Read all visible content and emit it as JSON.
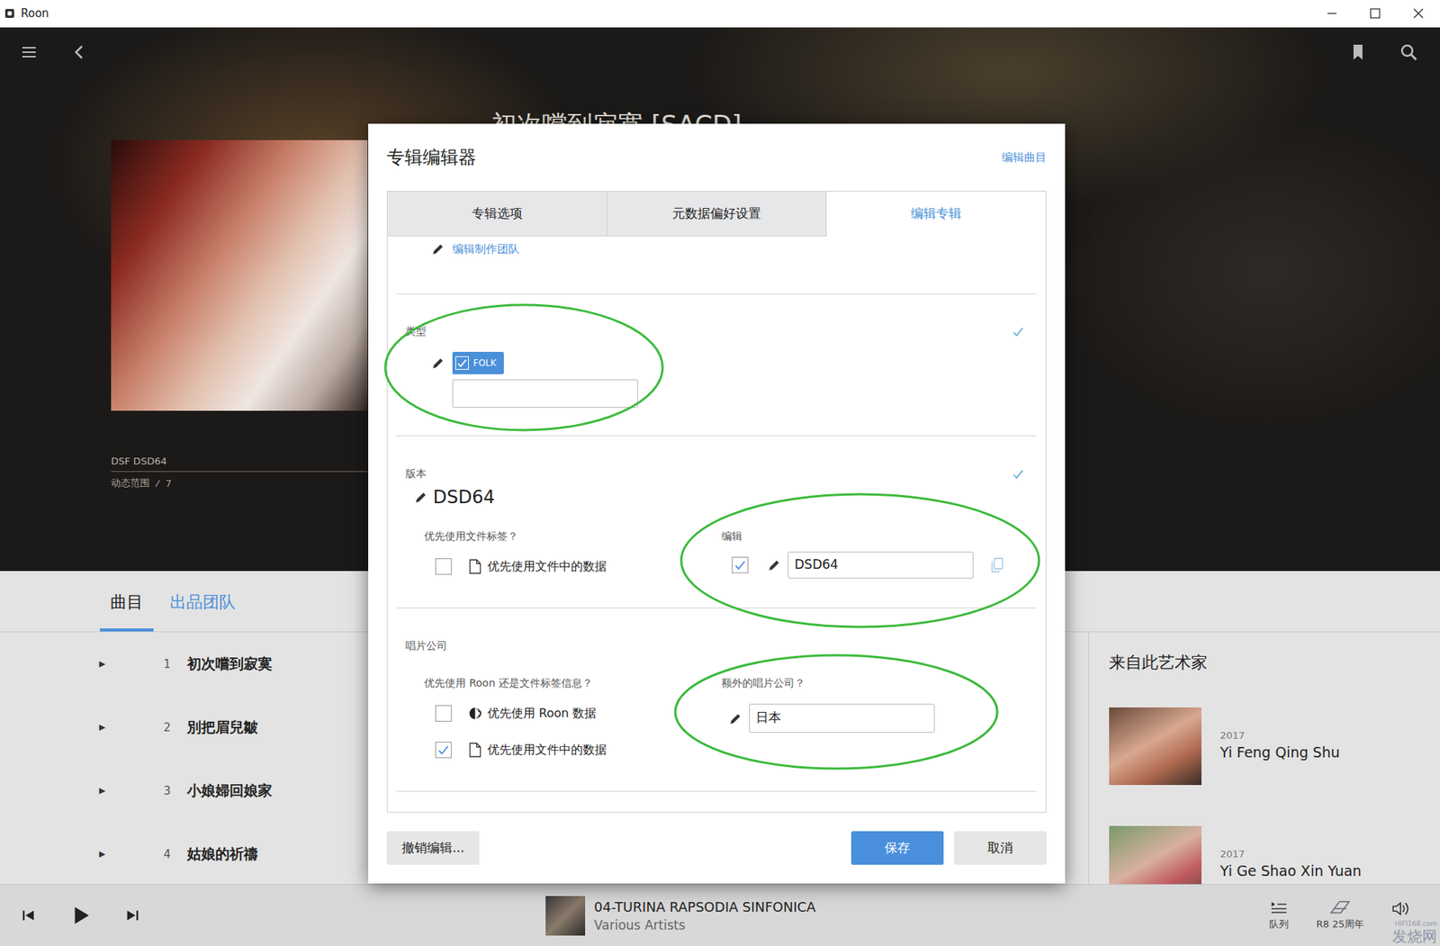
{
  "window": {
    "title": "Roon"
  },
  "album": {
    "title": "初次嚐到寂寞 [SACD]",
    "format": "DSF DSD64",
    "dynamic_range_label": "动态范围",
    "dynamic_range": "7"
  },
  "page_tabs": [
    {
      "label": "曲目",
      "selected": true
    },
    {
      "label": "出品团队",
      "selected": false
    }
  ],
  "tracks": {
    "glyph": "▶",
    "items": [
      {
        "number": "1",
        "title": "初次嚐到寂寞"
      },
      {
        "number": "2",
        "title": "別把眉兒皺"
      },
      {
        "number": "3",
        "title": "小娘婦回娘家"
      },
      {
        "number": "4",
        "title": "姑娘的祈禱"
      }
    ]
  },
  "artist_panel": {
    "title": "来自此艺术家",
    "albums": [
      {
        "year": "2017",
        "title": "Yi Feng Qing Shu"
      },
      {
        "year": "2017",
        "title": "Yi Ge Shao Xin Yuan"
      }
    ]
  },
  "player": {
    "track": "04-TURINA RAPSODIA SINFONICA",
    "artist": "Various Artists",
    "queue_label": "队列",
    "badge": "R8 25周年",
    "watermark_small": "HIFI168.com",
    "watermark": "发烧网"
  },
  "dialog": {
    "title": "专辑编辑器",
    "link": "编辑曲目",
    "tabs": [
      {
        "label": "专辑选项",
        "selected": false
      },
      {
        "label": "元数据偏好设置",
        "selected": false
      },
      {
        "label": "编辑专辑",
        "selected": true
      }
    ],
    "credits_link": "编辑制作团队",
    "genre": {
      "label": "类型",
      "confirmed": true,
      "tags": [
        {
          "label": "FOLK",
          "checked": true
        }
      ],
      "input": ""
    },
    "version": {
      "label": "版本",
      "value": "DSD64",
      "confirmed": true,
      "prefer_label": "优先使用文件标签？",
      "prefer_option": {
        "label": "优先使用文件中的数据",
        "checked": false
      },
      "edit_label": "编辑",
      "edit_checked": true,
      "edit_value": "DSD64"
    },
    "record_label": {
      "label": "唱片公司",
      "prefer_label": "优先使用 Roon 还是文件标签信息？",
      "options": [
        {
          "label": "优先使用 Roon 数据",
          "kind": "roon",
          "checked": false
        },
        {
          "label": "优先使用文件中的数据",
          "kind": "file",
          "checked": true
        }
      ],
      "extra_label": "额外的唱片公司？",
      "extra_value": "日本"
    },
    "buttons": {
      "revert": "撤销编辑...",
      "save": "保存",
      "cancel": "取消"
    }
  }
}
